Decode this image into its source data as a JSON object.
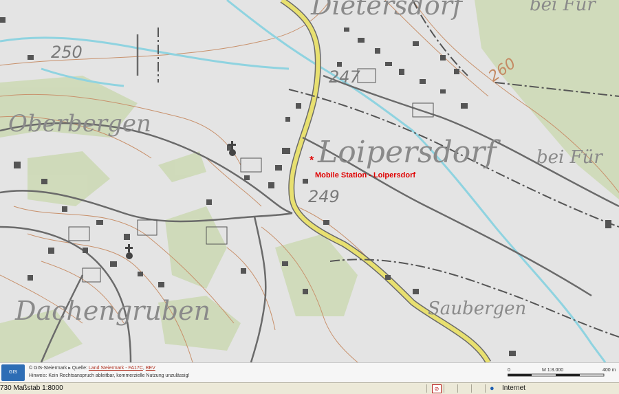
{
  "map": {
    "places": {
      "dietersdorf": "Dietersdorf",
      "dietersdorf_suffix": "bei Für",
      "oberbergen": "Oberbergen",
      "loipersdorf": "Loipersdorf",
      "loipersdorf_suffix": "bei Für",
      "dachengruben": "Dachengruben",
      "saubergen": "Saubergen"
    },
    "elevations": {
      "e250": "250",
      "e247": "247",
      "e249": "249",
      "e260": "260"
    },
    "marker": {
      "symbol": "*",
      "label": "Mobile Station - Loipersdorf",
      "color": "#e00000"
    },
    "colors": {
      "road": "#e8e070",
      "stream": "#8fd3e0",
      "contour": "#c8916c",
      "building": "#555555",
      "forest": "#c8d6b0"
    }
  },
  "footer": {
    "logo_text": "GIS",
    "brand_text": "© GIS-Steiermark",
    "source_prefix": "Quelle:",
    "source_link1": "Land Steiermark - FA17C",
    "source_link2": "BEV",
    "disclaimer": "Hinweis: Kein Rechtsanspruch ableitbar, kommerzielle Nutzung unzulässig!",
    "scale_left": "0",
    "scale_mid": "M 1:8.000",
    "scale_right": "400 m"
  },
  "statusbar": {
    "left_text": "730 Maßstab 1:8000",
    "zone_icon": "globe-icon",
    "zone_text": "Internet"
  }
}
